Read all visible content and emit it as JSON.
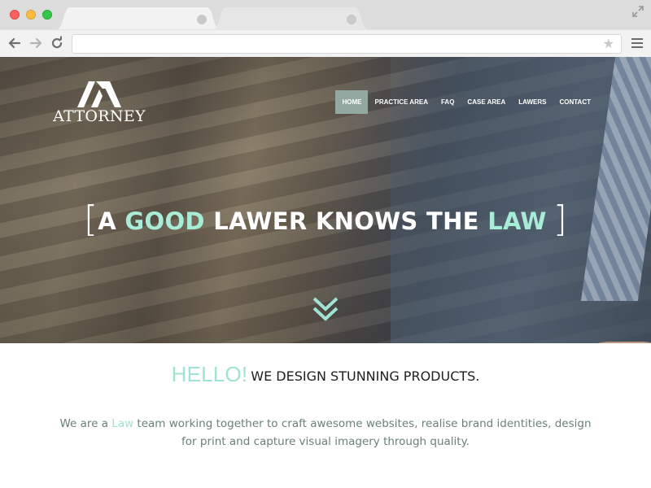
{
  "browser": {
    "address_value": "",
    "address_placeholder": "",
    "icons": [
      "back-arrow-icon",
      "forward-arrow-icon",
      "reload-icon",
      "star-icon",
      "menu-icon",
      "expand-icon"
    ],
    "traffic_light_colors": [
      "#fc605c",
      "#fdbc40",
      "#34c84a"
    ]
  },
  "site": {
    "logo_text": "ATTORNEY",
    "nav": [
      {
        "label": "HOME",
        "active": true
      },
      {
        "label": "PRACTICE AREA",
        "active": false
      },
      {
        "label": "FAQ",
        "active": false
      },
      {
        "label": "CASE AREA",
        "active": false
      },
      {
        "label": "LAWERS",
        "active": false
      },
      {
        "label": "CONTACT",
        "active": false
      }
    ],
    "hero": {
      "bracket_open": "[",
      "headline_part1": "A ",
      "headline_accent1": "GOOD",
      "headline_part2": " LAWER KNOWS THE ",
      "headline_accent2": "LAW",
      "bracket_close": "]"
    },
    "intro": {
      "hello": "HELLO!",
      "tagline": "WE DESIGN STUNNING PRODUCTS.",
      "text_before": "We are a ",
      "text_accent": "Law",
      "text_after": " team working together to craft awesome websites, realise brand identities, design for print and capture visual imagery through quality."
    },
    "colors": {
      "accent": "#a8ecd8",
      "nav_active_bg": "#93a8a1",
      "body_text": "#6a7f7b",
      "heading_text": "#1e1e1e"
    }
  }
}
